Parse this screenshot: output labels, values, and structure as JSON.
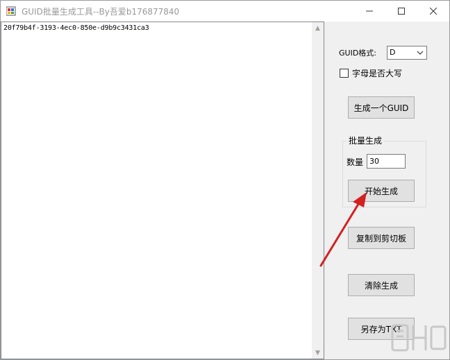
{
  "window": {
    "title": "GUID批量生成工具--By吾爱b176877840",
    "controls": {
      "minimize": "—",
      "maximize": "☐",
      "close": "✕"
    }
  },
  "output": {
    "text": "20f79b4f-3193-4ec0-850e-d9b9c3431ca3"
  },
  "format": {
    "label": "GUID格式:",
    "selected": "D"
  },
  "uppercase": {
    "label": "字母是否大写",
    "checked": false
  },
  "buttons": {
    "generate_one": "生成一个GUID",
    "start_generate": "开始生成",
    "copy_clipboard": "复制到剪切板",
    "clear": "清除生成",
    "save_txt": "另存为TXT"
  },
  "batch": {
    "title": "批量生成",
    "quantity_label": "数量",
    "quantity_value": "30"
  },
  "colors": {
    "annotation_arrow": "#d32020",
    "watermark": "#c8c8c8"
  }
}
